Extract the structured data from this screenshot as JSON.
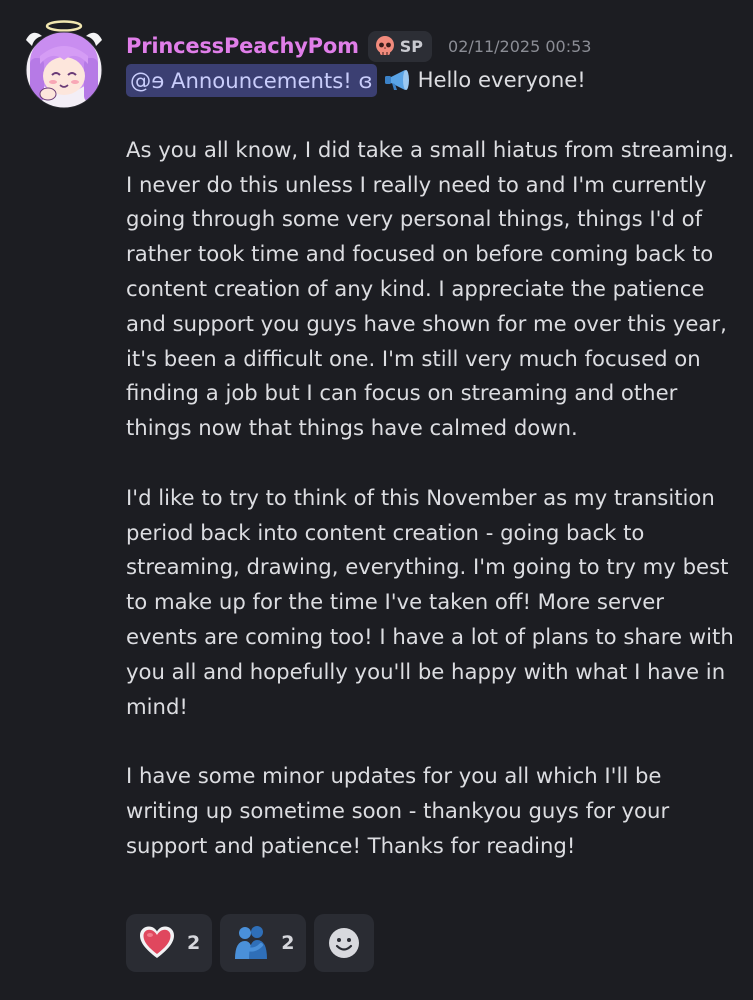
{
  "author": {
    "username": "PrincessPeachyPom",
    "role_tag": "SP",
    "role_icon": "skull-icon",
    "timestamp": "02/11/2025 00:53",
    "name_color": "#e07ee9"
  },
  "message": {
    "mention": "@ɘ Announcements! ɞ",
    "mention_icon": "megaphone-icon",
    "greeting": "Hello everyone!",
    "paragraphs": [
      "As you all know, I did take a small hiatus from streaming. I never do this unless I really need to and I'm currently going through some very personal things, things I'd of rather took time and focused on before coming back to content creation of any kind. I appreciate the patience and support you guys have shown for me over this year, it's been a difficult one. I'm still very much focused on finding a job but I can focus on streaming and other things now that things have calmed down.",
      "I'd like to try to think of this November as my transition period back into content creation - going back to streaming, drawing, everything. I'm going to try my best to make up for the time I've taken off! More server events are coming too! I have a lot of plans to share with you all and hopefully you'll be happy with what I have in mind!",
      "I have some minor updates for you all which I'll be writing up sometime soon - thankyou guys for your support and patience! Thanks for reading!"
    ]
  },
  "reactions": [
    {
      "emoji": "heart-icon",
      "count": "2"
    },
    {
      "emoji": "hugging-people-icon",
      "count": "2"
    },
    {
      "emoji": "add-reaction-icon"
    }
  ]
}
